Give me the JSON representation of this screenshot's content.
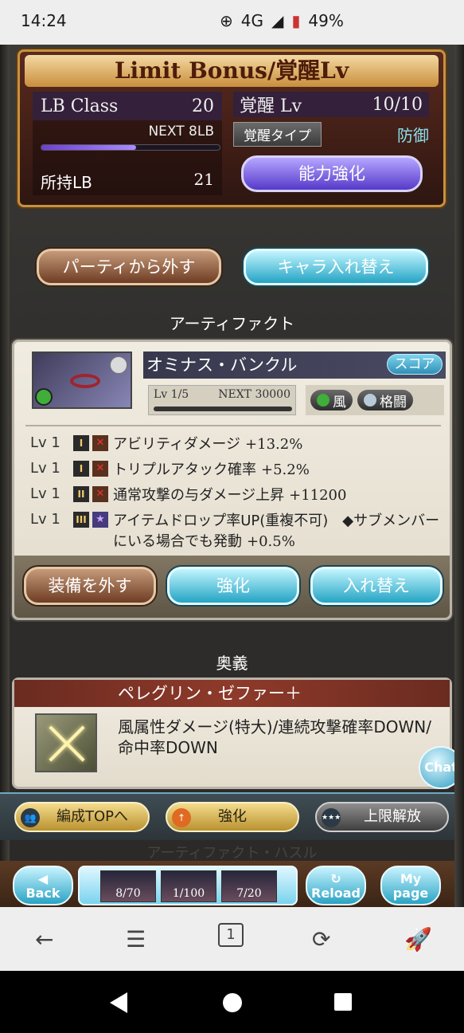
{
  "status": {
    "time": "14:24",
    "network": "4G",
    "battery": "49%"
  },
  "lb": {
    "title": "Limit Bonus/覚醒Lv",
    "class_label": "LB Class",
    "class_value": "20",
    "next": "NEXT 8LB",
    "progress": 0.53,
    "owned_label": "所持LB",
    "owned_value": "21",
    "kakusei_label": "覚醒 Lv",
    "kakusei_value": "10/10",
    "type_label": "覚醒タイプ",
    "type_value": "防御",
    "enhance_button": "能力強化"
  },
  "actions": {
    "remove_party": "パーティから外す",
    "swap_character": "キャラ入れ替え"
  },
  "artifact": {
    "heading": "アーティファクト",
    "name": "オミナス・バンクル",
    "score_button": "スコア",
    "level": "Lv 1/5",
    "next": "NEXT 30000",
    "element_tag": "風",
    "weapon_tag": "格闘",
    "skills": [
      {
        "lv": "Lv 1",
        "rank": "I",
        "text": "アビリティダメージ",
        "value": "+13.2%"
      },
      {
        "lv": "Lv 1",
        "rank": "I",
        "text": "トリプルアタック確率",
        "value": "+5.2%"
      },
      {
        "lv": "Lv 1",
        "rank": "II",
        "text": "通常攻撃の与ダメージ上昇",
        "value": "+11200"
      },
      {
        "lv": "Lv 1",
        "rank": "III",
        "text": "アイテムドロップ率UP(重複不可)　◆サブメンバーにいる場合でも発動",
        "value": "+0.5%"
      }
    ],
    "unequip_button": "装備を外す",
    "enhance_button": "強化",
    "swap_button": "入れ替え"
  },
  "ougi": {
    "heading": "奥義",
    "name": "ペレグリン・ゼファー＋",
    "description": "風属性ダメージ(特大)/連続攻撃確率DOWN/命中率DOWN"
  },
  "chat": "Chat",
  "toolbar": {
    "party_top": "編成TOPへ",
    "enhance": "強化",
    "limit_break": "上限解放"
  },
  "faded_text": "アーティファクト・ハスル",
  "bottom_nav": {
    "back": "Back",
    "reload": "Reload",
    "mypage_1": "My",
    "mypage_2": "page",
    "item1": "8/70",
    "item2": "1/100",
    "item3": "7/20"
  },
  "system_nav": {
    "tabs_count": "1"
  }
}
